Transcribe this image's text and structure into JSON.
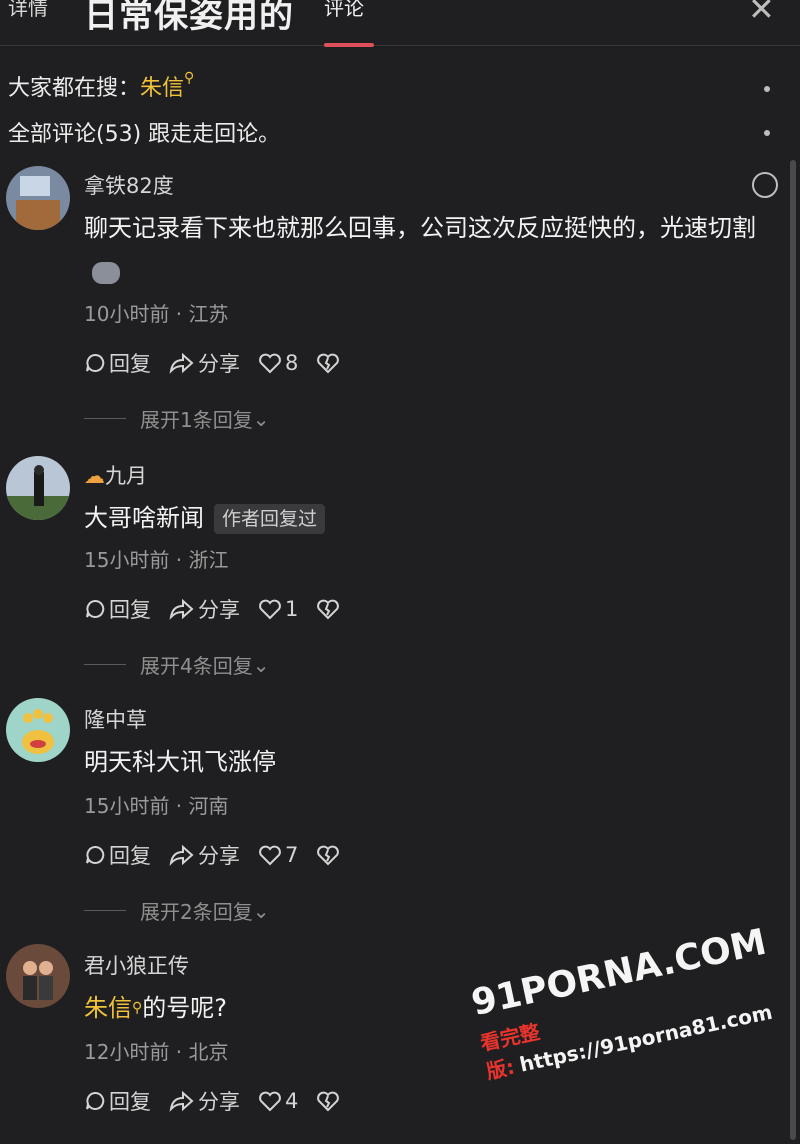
{
  "header": {
    "tab_detail": "详情",
    "title_overlay": "日常保姿用的",
    "tab_comments": "评论",
    "close_label": "✕"
  },
  "search": {
    "prefix": "大家都在搜：",
    "term": "朱信"
  },
  "comments_header": {
    "text": "全部评论(53) 跟走走回论。"
  },
  "comments": [
    {
      "username": "拿铁82度",
      "text": "聊天记录看下来也就那么回事，公司这次反应挺快的，光速切割",
      "meta": "10小时前 · 江苏",
      "reply_label": "回复",
      "share_label": "分享",
      "likes": "8",
      "expand": "展开1条回复"
    },
    {
      "username": "九月",
      "text": "大哥啥新闻",
      "badge": "作者回复过",
      "meta": "15小时前 · 浙江",
      "reply_label": "回复",
      "share_label": "分享",
      "likes": "1",
      "expand": "展开4条回复"
    },
    {
      "username": "隆中草",
      "text": "明天科大讯飞涨停",
      "meta": "15小时前 · 河南",
      "reply_label": "回复",
      "share_label": "分享",
      "likes": "7",
      "expand": "展开2条回复"
    },
    {
      "username": "君小狼正传",
      "text_highlight": "朱信",
      "text_rest": "的号呢?",
      "meta": "12小时前 · 北京",
      "reply_label": "回复",
      "share_label": "分享",
      "likes": "4"
    }
  ],
  "watermark": {
    "logo": "91PORNA.COM",
    "url": "https://91porna81.com",
    "label": "看完整版:"
  },
  "colors": {
    "background": "#1f1f21",
    "highlight": "#f1c33a",
    "tab_accent": "#e0505a"
  }
}
